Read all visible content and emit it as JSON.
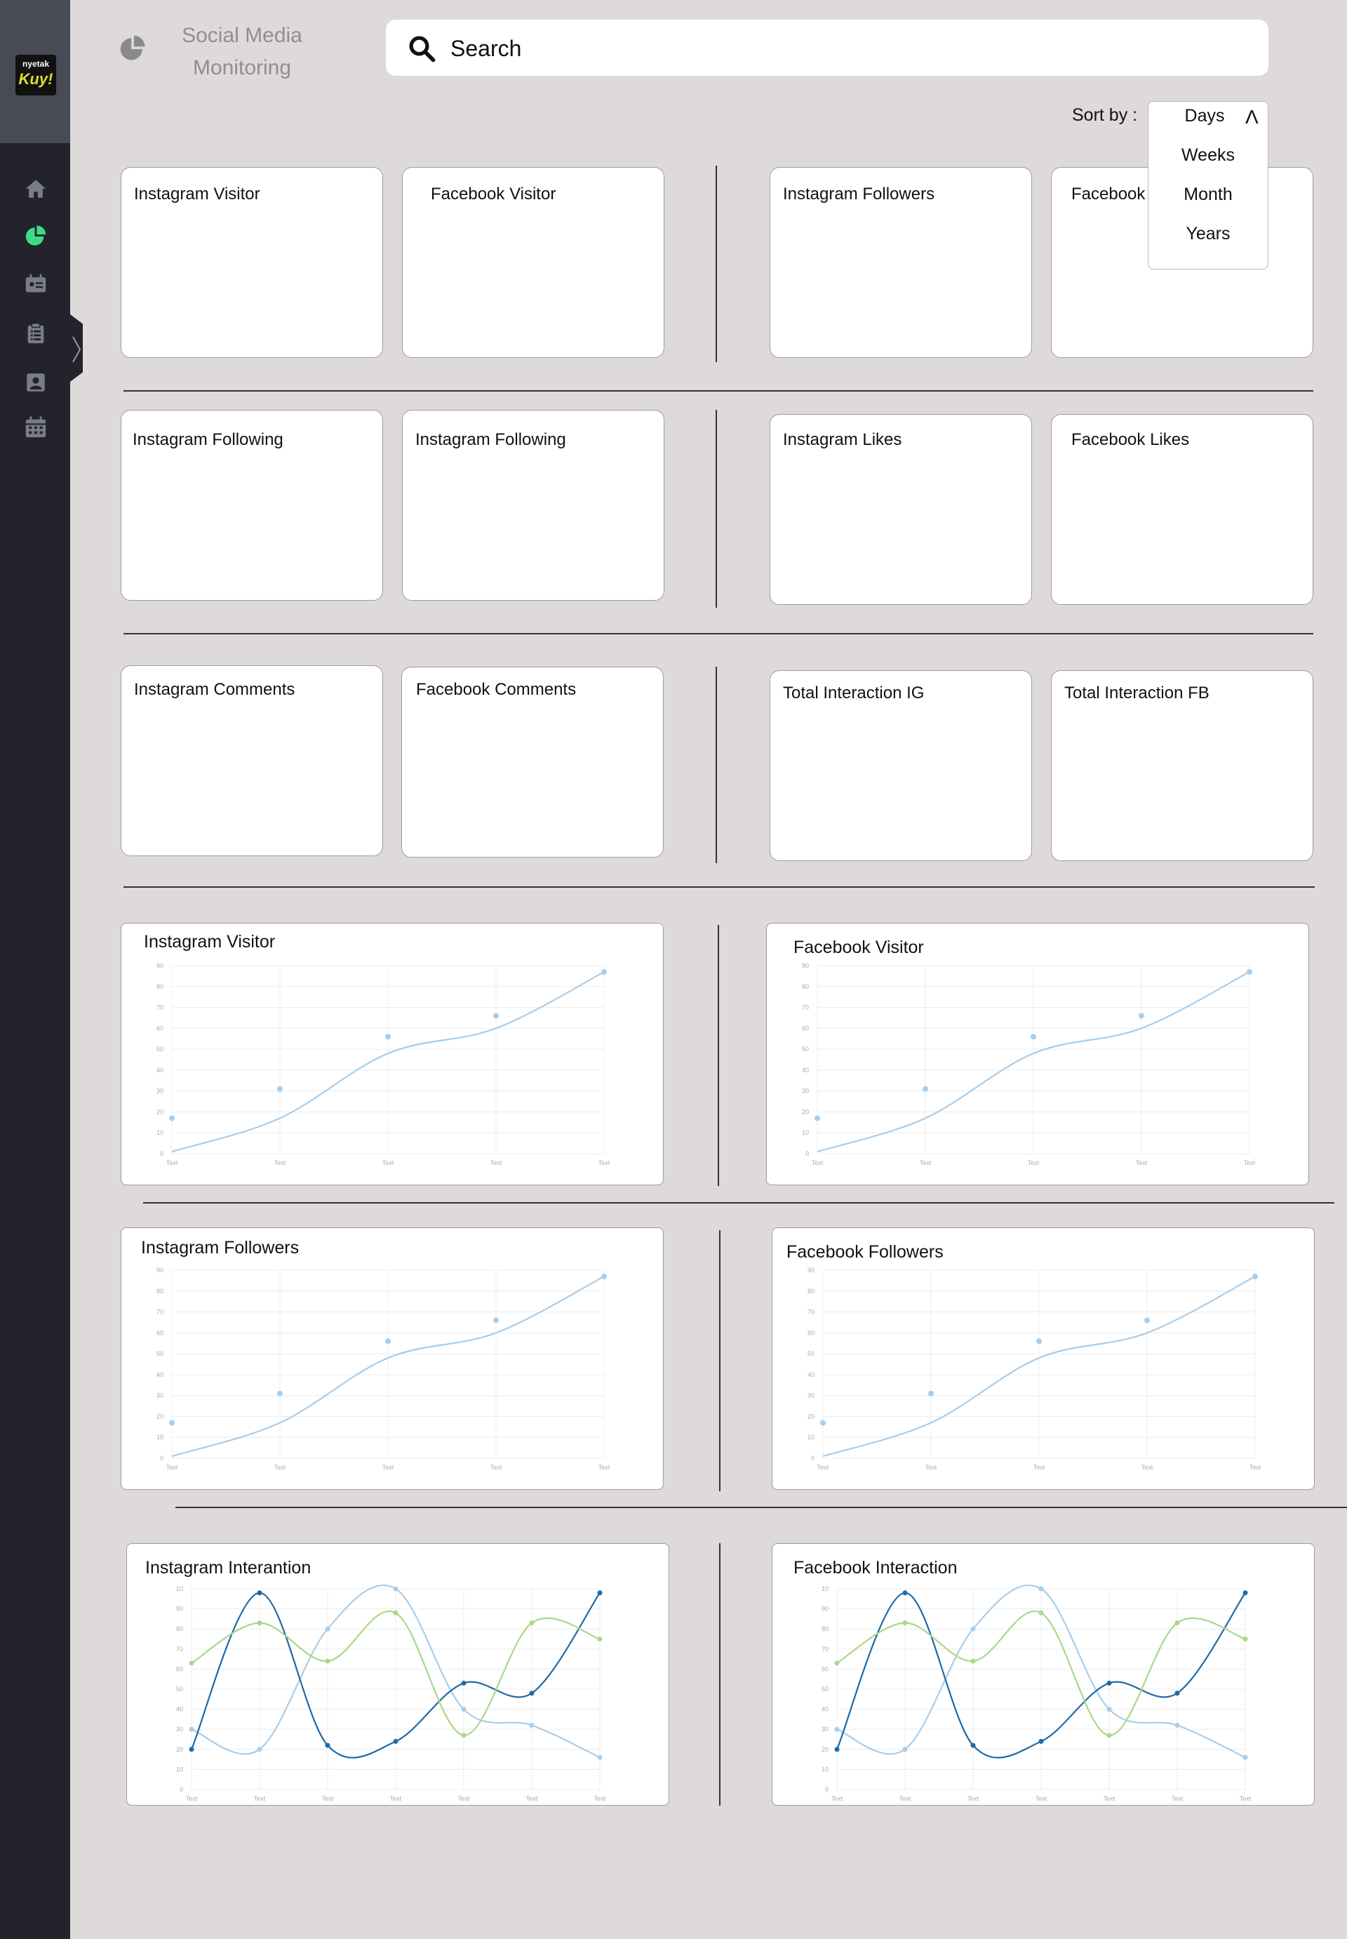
{
  "app": {
    "title": "Social Media Monitoring",
    "logo_text_top": "nyetak",
    "logo_text_bottom": "Kuy!"
  },
  "search": {
    "placeholder": "Search"
  },
  "sort": {
    "label": "Sort by :",
    "options": [
      "Days",
      "Weeks",
      "Month",
      "Years"
    ],
    "caret": "^"
  },
  "sidebar": {
    "items": [
      {
        "icon": "home-icon"
      },
      {
        "icon": "pie-chart-icon",
        "active": true
      },
      {
        "icon": "id-card-icon"
      },
      {
        "icon": "clipboard-icon"
      },
      {
        "icon": "contact-icon"
      },
      {
        "icon": "calendar-icon"
      }
    ]
  },
  "stat_cards": {
    "row1": [
      "Instagram Visitor",
      "Facebook Visitor",
      "Instagram Followers",
      "Facebook"
    ],
    "row2": [
      "Instagram Following",
      "Instagram Following",
      "Instagram Likes",
      "Facebook Likes"
    ],
    "row3": [
      "Instagram Comments",
      "Facebook Comments",
      "Total Interaction IG",
      "Total Interaction FB"
    ]
  },
  "colors": {
    "accent": "#3ddc84",
    "line_light": "#a9cde9",
    "line_dark": "#1e6aa8",
    "line_green": "#a8d88a"
  },
  "charts": [
    {
      "id": "ig-visitor",
      "title": "Instagram Visitor"
    },
    {
      "id": "fb-visitor",
      "title": "Facebook Visitor"
    },
    {
      "id": "ig-followers",
      "title": "Instagram Followers"
    },
    {
      "id": "fb-followers",
      "title": "Facebook Followers"
    },
    {
      "id": "ig-interaction",
      "title": "Instagram Interantion"
    },
    {
      "id": "fb-interaction",
      "title": "Facebook Interaction"
    }
  ],
  "chart_data": [
    {
      "type": "line",
      "title": "Instagram Visitor",
      "categories": [
        "Text",
        "Text",
        "Text",
        "Text",
        "Text"
      ],
      "y_ticks": [
        0,
        10,
        20,
        30,
        40,
        50,
        60,
        70,
        80,
        90
      ],
      "ylim": [
        0,
        90
      ],
      "series": [
        {
          "values": [
            1,
            17,
            48,
            60,
            87
          ]
        },
        {
          "values": [
            17,
            31,
            56,
            66,
            87
          ]
        }
      ],
      "grid": true
    },
    {
      "type": "line",
      "title": "Facebook Visitor",
      "categories": [
        "Text",
        "Text",
        "Text",
        "Text",
        "Text"
      ],
      "y_ticks": [
        0,
        10,
        20,
        30,
        40,
        50,
        60,
        70,
        80,
        90
      ],
      "ylim": [
        0,
        90
      ],
      "series": [
        {
          "values": [
            1,
            17,
            48,
            60,
            87
          ]
        },
        {
          "values": [
            17,
            31,
            56,
            66,
            87
          ]
        }
      ],
      "grid": true
    },
    {
      "type": "line",
      "title": "Instagram Followers",
      "categories": [
        "Text",
        "Text",
        "Text",
        "Text",
        "Text"
      ],
      "y_ticks": [
        0,
        10,
        20,
        30,
        40,
        50,
        60,
        70,
        80,
        90
      ],
      "ylim": [
        0,
        90
      ],
      "series": [
        {
          "values": [
            1,
            17,
            48,
            60,
            87
          ]
        },
        {
          "values": [
            17,
            31,
            56,
            66,
            87
          ]
        }
      ],
      "grid": true
    },
    {
      "type": "line",
      "title": "Facebook Followers",
      "categories": [
        "Text",
        "Text",
        "Text",
        "Text",
        "Text"
      ],
      "y_ticks": [
        0,
        10,
        20,
        30,
        40,
        50,
        60,
        70,
        80,
        90
      ],
      "ylim": [
        0,
        90
      ],
      "series": [
        {
          "values": [
            1,
            17,
            48,
            60,
            87
          ]
        },
        {
          "values": [
            17,
            31,
            56,
            66,
            87
          ]
        }
      ],
      "grid": true
    },
    {
      "type": "line",
      "title": "Instagram Interantion",
      "categories": [
        "Text",
        "Text",
        "Text",
        "Text",
        "Text",
        "Text",
        "Text"
      ],
      "y_ticks": [
        0,
        10,
        20,
        30,
        40,
        50,
        60,
        70,
        80,
        90,
        10
      ],
      "ylim": [
        0,
        100
      ],
      "series": [
        {
          "values": [
            30,
            20,
            80,
            100,
            40,
            32,
            16
          ]
        },
        {
          "values": [
            20,
            98,
            22,
            24,
            53,
            48,
            98
          ]
        },
        {
          "values": [
            63,
            83,
            64,
            88,
            27,
            83,
            75
          ]
        }
      ],
      "grid": true
    },
    {
      "type": "line",
      "title": "Facebook Interaction",
      "categories": [
        "Text",
        "Text",
        "Text",
        "Text",
        "Text",
        "Text",
        "Text"
      ],
      "y_ticks": [
        0,
        10,
        20,
        30,
        40,
        50,
        60,
        70,
        80,
        90,
        10
      ],
      "ylim": [
        0,
        100
      ],
      "series": [
        {
          "values": [
            30,
            20,
            80,
            100,
            40,
            32,
            16
          ]
        },
        {
          "values": [
            20,
            98,
            22,
            24,
            53,
            48,
            98
          ]
        },
        {
          "values": [
            63,
            83,
            64,
            88,
            27,
            83,
            75
          ]
        }
      ],
      "grid": true
    }
  ]
}
